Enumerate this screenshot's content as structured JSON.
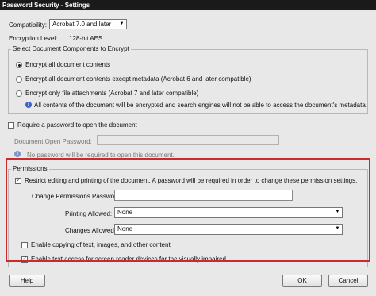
{
  "window": {
    "title": "Password Security - Settings"
  },
  "compatibility": {
    "label": "Compatibility:",
    "value": "Acrobat 7.0 and later"
  },
  "encryption": {
    "label": "Encryption  Level:",
    "value": "128-bit AES"
  },
  "components": {
    "legend": "Select Document Components to Encrypt",
    "options": [
      "Encrypt all document contents",
      "Encrypt all document contents except metadata (Acrobat 6 and later compatible)",
      "Encrypt only file attachments (Acrobat 7 and later compatible)"
    ],
    "info": "All contents of the document will be encrypted and search engines will not be able to access the document's metadata."
  },
  "open_password": {
    "checkbox_label": "Require a password to open the document",
    "field_label": "Document Open Password:",
    "info": "No password will be required to open this document."
  },
  "permissions": {
    "legend": "Permissions",
    "restrict_label": "Restrict editing and printing of the document. A password will be required in order to change these permission settings.",
    "change_password_label": "Change Permissions Password:",
    "printing_label": "Printing Allowed:",
    "printing_value": "None",
    "changes_label": "Changes Allowed:",
    "changes_value": "None",
    "copy_label": "Enable copying of text, images, and other content",
    "screen_reader_label": "Enable text access for screen reader devices for the visually impaired"
  },
  "buttons": {
    "help": "Help",
    "ok": "OK",
    "cancel": "Cancel"
  }
}
